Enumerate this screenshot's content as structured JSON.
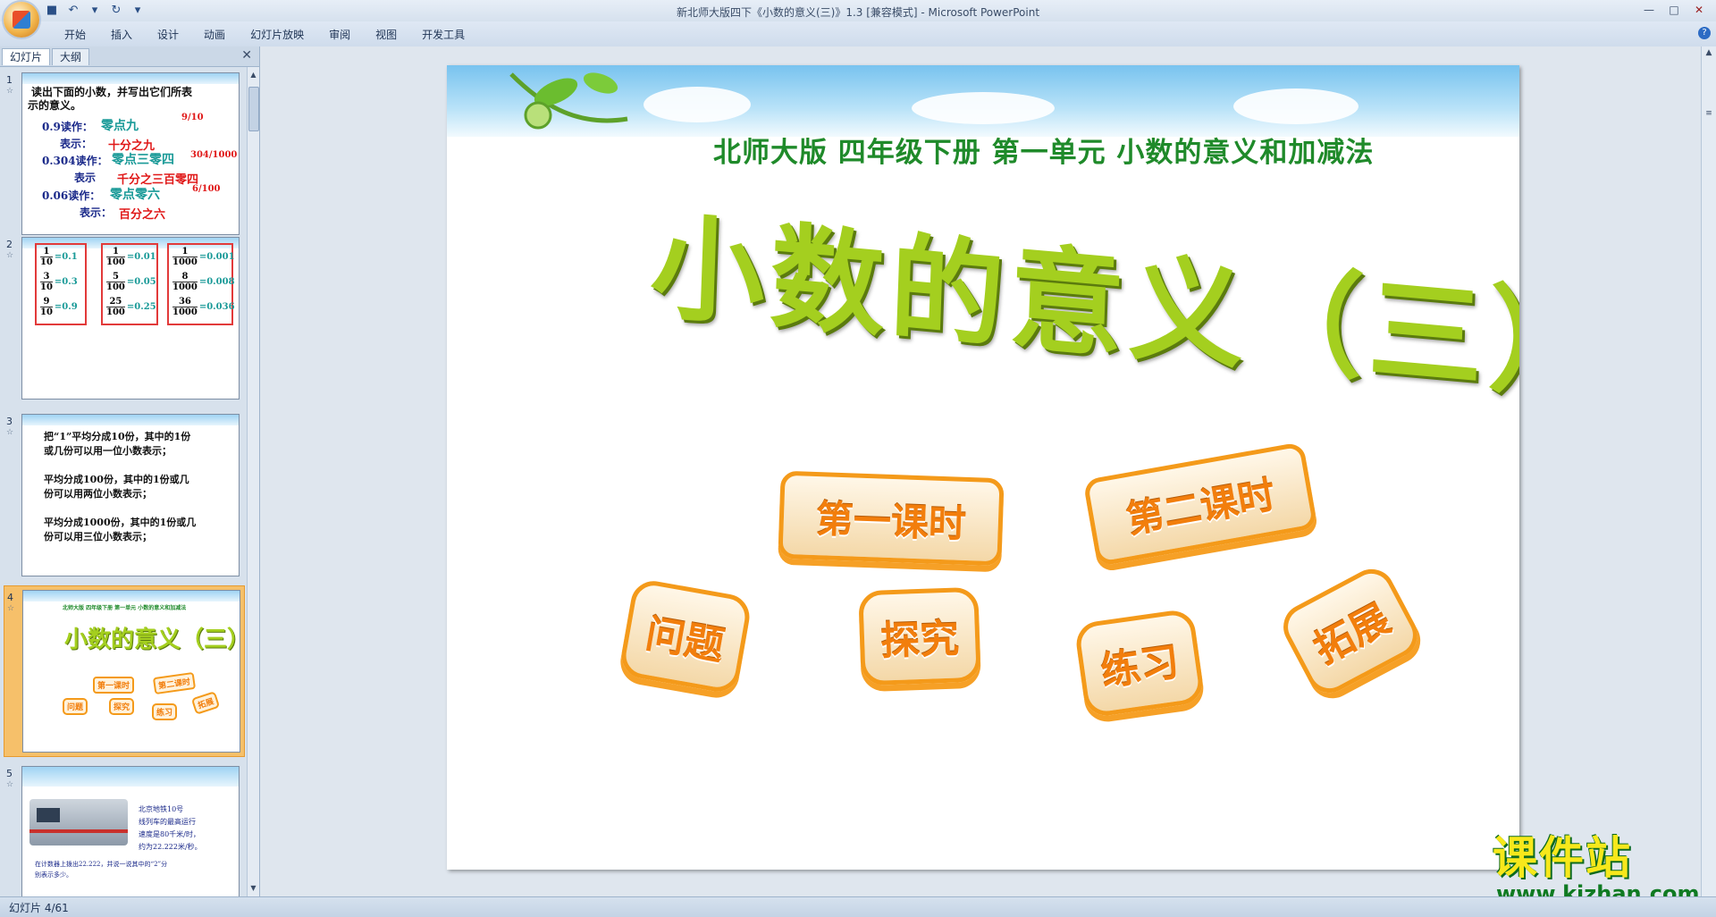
{
  "window": {
    "title": "新北师大版四下《小数的意义(三)》1.3 [兼容模式] - Microsoft PowerPoint",
    "controls": [
      "—",
      "□",
      "✕"
    ]
  },
  "ribbon": {
    "tabs": [
      "开始",
      "插入",
      "设计",
      "动画",
      "幻灯片放映",
      "审阅",
      "视图",
      "开发工具"
    ]
  },
  "pane": {
    "tabs": [
      "幻灯片",
      "大纲"
    ],
    "close": "✕"
  },
  "thumbnails": [
    {
      "num": "1",
      "star": "☆",
      "lines": [
        {
          "text": "读出下面的小数，并写出它们所表",
          "cls": "black"
        },
        {
          "text": "示的意义。",
          "cls": "black"
        },
        {
          "text": "0.9读作：",
          "cls": "navy"
        },
        {
          "text": "零点九",
          "cls": "teal"
        },
        {
          "text": "9/10",
          "cls": "red"
        },
        {
          "text": "表示：",
          "cls": "navy"
        },
        {
          "text": "十分之九",
          "cls": "red"
        },
        {
          "text": "0.304读作：",
          "cls": "navy"
        },
        {
          "text": "零点三零四",
          "cls": "teal"
        },
        {
          "text": "304/1000",
          "cls": "red"
        },
        {
          "text": "表示",
          "cls": "navy"
        },
        {
          "text": "千分之三百零四",
          "cls": "red"
        },
        {
          "text": "0.06读作：",
          "cls": "navy"
        },
        {
          "text": "零点零六",
          "cls": "teal"
        },
        {
          "text": "6/100",
          "cls": "red"
        },
        {
          "text": "表示：",
          "cls": "navy"
        },
        {
          "text": "百分之六",
          "cls": "red"
        }
      ]
    },
    {
      "num": "2",
      "star": "☆",
      "columns": [
        [
          {
            "n": "1",
            "d": "10",
            "v": "0.1"
          },
          {
            "n": "3",
            "d": "10",
            "v": "0.3"
          },
          {
            "n": "9",
            "d": "10",
            "v": "0.9"
          }
        ],
        [
          {
            "n": "1",
            "d": "100",
            "v": "0.01"
          },
          {
            "n": "5",
            "d": "100",
            "v": "0.05"
          },
          {
            "n": "25",
            "d": "100",
            "v": "0.25"
          }
        ],
        [
          {
            "n": "1",
            "d": "1000",
            "v": "0.001"
          },
          {
            "n": "8",
            "d": "1000",
            "v": "0.008"
          },
          {
            "n": "36",
            "d": "1000",
            "v": "0.036"
          }
        ]
      ]
    },
    {
      "num": "3",
      "star": "☆",
      "lines": [
        "把“1”平均分成10份，其中的1份",
        "或几份可以用一位小数表示；",
        "平均分成100份，其中的1份或几",
        "份可以用两位小数表示；",
        "平均分成1000份，其中的1份或几",
        "份可以用三位小数表示；"
      ]
    },
    {
      "num": "4",
      "star": "☆",
      "subtitle": "北师大版 四年级下册 第一单元 小数的意义和加减法",
      "title": "小数的意义（三）",
      "badges": [
        "第一课时",
        "第二课时",
        "问题",
        "探究",
        "练习",
        "拓展"
      ]
    },
    {
      "num": "5",
      "star": "☆",
      "lines": [
        "北京地铁10号",
        "线列车的最高运行",
        "速度是80千米/时，",
        "约为22.222米/秒。",
        "在计数器上拨出22.222，并说一说其中的“2”分",
        "别表示多少。"
      ]
    }
  ],
  "slide": {
    "subtitle": "北师大版  四年级下册  第一单元  小数的意义和加减法",
    "title": "小数的意义（三）",
    "badges": {
      "lesson1": "第一课时",
      "lesson2": "第二课时",
      "question": "问题",
      "explore": "探究",
      "practice": "练习",
      "extend": "拓展"
    }
  },
  "status": {
    "text": "幻灯片 4/61"
  },
  "watermark": {
    "main": "课件站",
    "url": "www.kjzhan.com"
  },
  "colors": {
    "title_green": "#a4cf1f",
    "subtitle_green": "#1f8a2a",
    "badge_orange": "#f49a1a",
    "selected_thumb": "#f6c06a"
  }
}
